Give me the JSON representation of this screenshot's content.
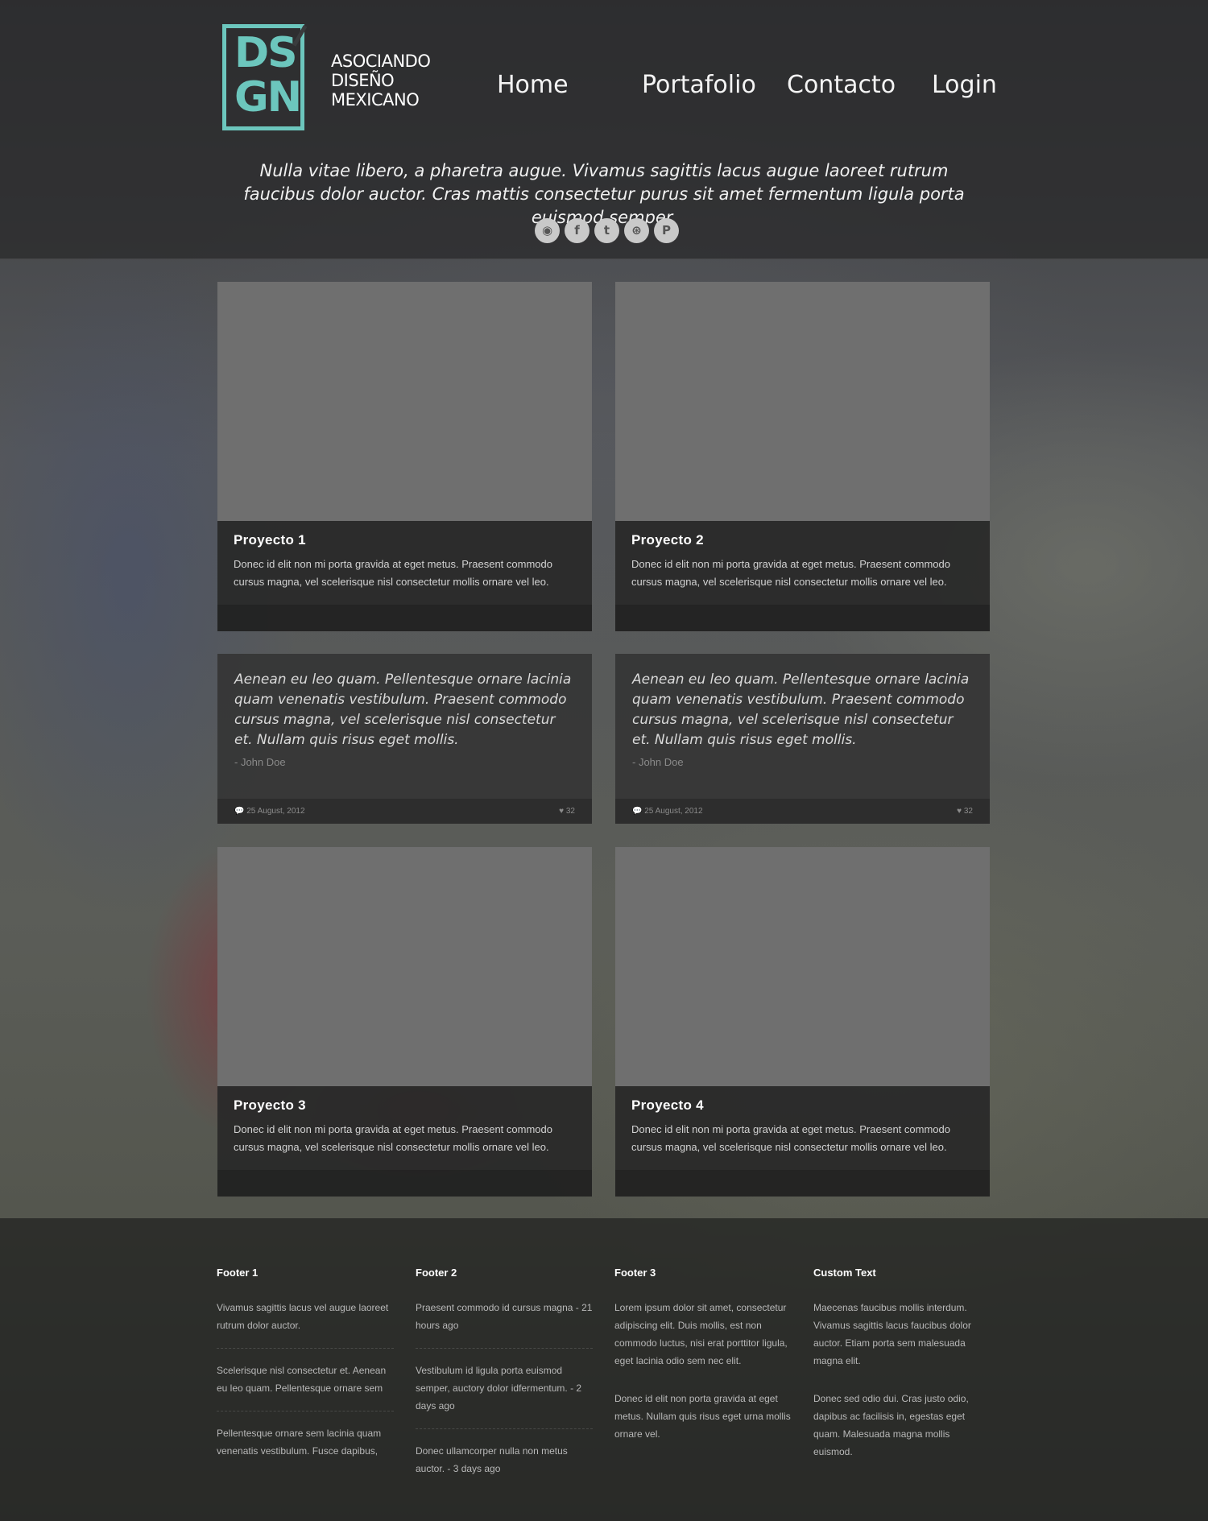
{
  "colors": {
    "accent": "#6cc6bd",
    "card_image_placeholder": "#6f6f6f"
  },
  "logo": {
    "mark": "DS GN",
    "tagline": [
      "ASOCIANDO",
      "DISEÑO",
      "MEXICANO"
    ]
  },
  "nav": {
    "items": [
      "Home",
      "Portafolio",
      "Contacto",
      "Login"
    ]
  },
  "hero": {
    "text": "Nulla vitae libero, a pharetra augue. Vivamus sagittis lacus augue laoreet rutrum faucibus dolor auctor. Cras mattis consectetur purus sit amet fermentum ligula porta euismod semper."
  },
  "social": [
    {
      "icon": "rss-icon",
      "glyph": "◉"
    },
    {
      "icon": "facebook-icon",
      "glyph": "f"
    },
    {
      "icon": "twitter-icon",
      "glyph": "t"
    },
    {
      "icon": "dribbble-icon",
      "glyph": "⊛"
    },
    {
      "icon": "pinterest-icon",
      "glyph": "P"
    }
  ],
  "projects": [
    {
      "title": "Proyecto 1",
      "text": "Donec id elit non mi porta gravida at eget metus. Praesent commodo cursus magna, vel scelerisque nisl consectetur mollis ornare vel leo."
    },
    {
      "title": "Proyecto 2",
      "text": "Donec id elit non mi porta gravida at eget metus. Praesent commodo cursus magna, vel scelerisque nisl consectetur mollis ornare vel leo."
    },
    {
      "title": "Proyecto 3",
      "text": "Donec id elit non mi porta gravida at eget metus. Praesent commodo cursus magna, vel scelerisque nisl consectetur mollis ornare vel leo."
    },
    {
      "title": "Proyecto 4",
      "text": "Donec id elit non mi porta gravida at eget metus. Praesent commodo cursus magna, vel scelerisque nisl consectetur mollis ornare vel leo."
    }
  ],
  "quotes": [
    {
      "text": "Aenean eu leo quam. Pellentesque ornare lacinia quam venenatis vestibulum. Praesent commodo cursus magna, vel scelerisque nisl consectetur et. Nullam quis risus eget mollis.",
      "author": "- John Doe",
      "date": "25 August, 2012",
      "likes": "32"
    },
    {
      "text": "Aenean eu leo quam. Pellentesque ornare lacinia quam venenatis vestibulum. Praesent commodo cursus magna, vel scelerisque nisl consectetur et. Nullam quis risus eget mollis.",
      "author": "- John Doe",
      "date": "25 August, 2012",
      "likes": "32"
    }
  ],
  "footer": {
    "col1": {
      "title": "Footer 1",
      "items": [
        "Vivamus sagittis lacus vel augue laoreet rutrum dolor auctor.",
        "Scelerisque nisl consectetur et. Aenean eu leo quam. Pellentesque ornare sem",
        "Pellentesque ornare sem lacinia quam venenatis vestibulum. Fusce dapibus,"
      ]
    },
    "col2": {
      "title": "Footer 2",
      "items": [
        "Praesent commodo id cursus magna - 21 hours ago",
        "Vestibulum id ligula porta euismod semper, auctory dolor idfermentum. - 2 days ago",
        "Donec ullamcorper nulla non metus auctor. - 3 days ago"
      ]
    },
    "col3": {
      "title": "Footer 3",
      "paras": [
        "Lorem ipsum dolor sit amet, consectetur adipiscing elit. Duis mollis, est non commodo luctus, nisi erat porttitor ligula, eget lacinia odio sem nec elit.",
        "Donec id elit non porta gravida at eget metus. Nullam quis risus eget urna mollis ornare vel."
      ]
    },
    "col4": {
      "title": "Custom Text",
      "paras": [
        "Maecenas faucibus mollis interdum. Vivamus sagittis lacus  faucibus dolor auctor. Etiam porta sem malesuada magna elit.",
        "Donec sed odio dui. Cras justo odio, dapibus ac facilisis in, egestas eget quam. Malesuada magna mollis euismod."
      ]
    }
  }
}
